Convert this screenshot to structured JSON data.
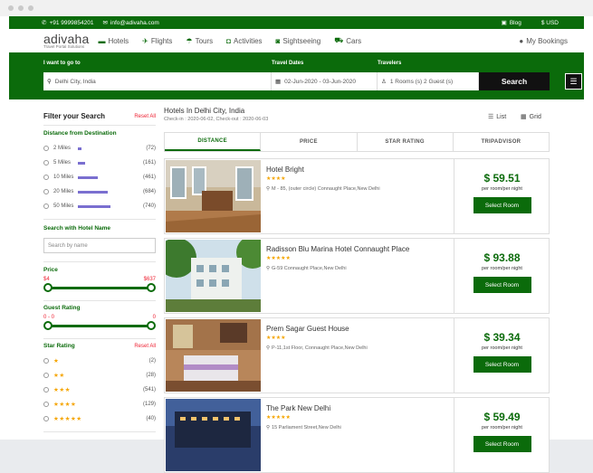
{
  "topbar": {
    "phone": "+91 9999854201",
    "email": "info@adivaha.com",
    "blog": "Blog",
    "currency": "$ USD"
  },
  "nav": {
    "brand": "adivaha",
    "tagline": "Travel Portal Solutions",
    "items": [
      {
        "label": "Hotels",
        "icon": "bed-icon"
      },
      {
        "label": "Flights",
        "icon": "plane-icon"
      },
      {
        "label": "Tours",
        "icon": "umbrella-icon"
      },
      {
        "label": "Activities",
        "icon": "binoculars-icon"
      },
      {
        "label": "Sightseeing",
        "icon": "camera-icon"
      },
      {
        "label": "Cars",
        "icon": "car-icon"
      }
    ],
    "bookings": "My Bookings"
  },
  "search": {
    "goto_label": "I want to go to",
    "destination": "Delhi City, India",
    "dates_label": "Travel Dates",
    "dates": "02-Jun-2020 - 03-Jun-2020",
    "travelers_label": "Travelers",
    "travelers": "1 Rooms (s) 2 Guest (s)",
    "button": "Search"
  },
  "filters": {
    "title": "Filter your Search",
    "reset": "Reset All",
    "distance_title": "Distance from Destination",
    "distances": [
      {
        "label": "2 Miles",
        "count": "(72)",
        "fraction": 0.1
      },
      {
        "label": "5 Miles",
        "count": "(161)",
        "fraction": 0.22
      },
      {
        "label": "10 Miles",
        "count": "(461)",
        "fraction": 0.62
      },
      {
        "label": "20 Miles",
        "count": "(684)",
        "fraction": 0.92
      },
      {
        "label": "50 Miles",
        "count": "(740)",
        "fraction": 1.0
      }
    ],
    "name_title": "Search with Hotel Name",
    "name_placeholder": "Search by name",
    "price_title": "Price",
    "price_min": "$4",
    "price_max": "$637",
    "guest_title": "Guest Rating",
    "guest_min": "0 - 0",
    "guest_max": "0",
    "star_title": "Star Rating",
    "star_reset": "Reset All",
    "stars": [
      {
        "stars": "★",
        "count": "(2)"
      },
      {
        "stars": "★★",
        "count": "(28)"
      },
      {
        "stars": "★★★",
        "count": "(541)"
      },
      {
        "stars": "★★★★",
        "count": "(129)"
      },
      {
        "stars": "★★★★★",
        "count": "(40)"
      }
    ]
  },
  "results": {
    "title": "Hotels In Delhi City, India",
    "subtitle": "Check-in : 2020-06-02, Check-out : 2020-06-03",
    "view_list": "List",
    "view_grid": "Grid",
    "sort_tabs": [
      "DISTANCE",
      "PRICE",
      "STAR RATING",
      "TRIPADVISOR"
    ],
    "per_night": "per room/per night",
    "select": "Select Room",
    "hotels": [
      {
        "name": "Hotel Bright",
        "stars": "★★★★",
        "address": "M - 85, (outer circle) Connaught Place,New Delhi",
        "price": "$ 59.51"
      },
      {
        "name": "Radisson Blu Marina Hotel Connaught Place",
        "stars": "★★★★★",
        "address": "G-59 Connaught Place,New Delhi",
        "price": "$ 93.88"
      },
      {
        "name": "Prem Sagar Guest House",
        "stars": "★★★★",
        "address": "P-11,1st Floor, Connaught Place,New Delhi",
        "price": "$ 39.34"
      },
      {
        "name": "The Park New Delhi",
        "stars": "★★★★★",
        "address": "15 Parliament Street,New Delhi",
        "price": "$ 59.49"
      }
    ]
  }
}
